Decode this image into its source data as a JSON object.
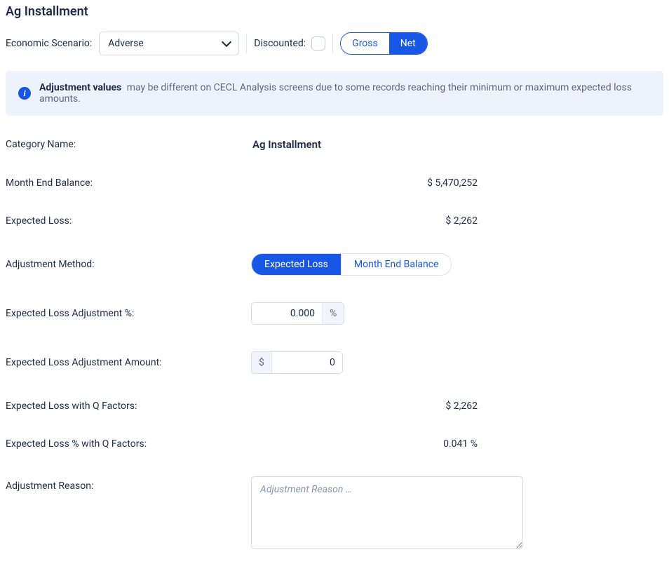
{
  "page_title": "Ag Installment",
  "controls": {
    "scenario_label": "Economic Scenario:",
    "scenario_value": "Adverse",
    "discounted_label": "Discounted:",
    "discounted_checked": false,
    "gross_label": "Gross",
    "net_label": "Net",
    "grossnet_active": "Net"
  },
  "banner": {
    "bold": "Adjustment values",
    "rest": "may be different on CECL Analysis screens due to some records reaching their minimum or maximum expected loss amounts."
  },
  "fields": {
    "category_name": {
      "label": "Category Name:",
      "value": "Ag Installment"
    },
    "month_end_balance": {
      "label": "Month End Balance:",
      "value": "$ 5,470,252"
    },
    "expected_loss": {
      "label": "Expected Loss:",
      "value": "$ 2,262"
    },
    "adjustment_method": {
      "label": "Adjustment Method:",
      "opt_expected_loss": "Expected Loss",
      "opt_month_end": "Month End Balance",
      "active": "Expected Loss"
    },
    "adj_pct": {
      "label": "Expected Loss Adjustment %:",
      "value": "0.000",
      "suffix": "%"
    },
    "adj_amt": {
      "label": "Expected Loss Adjustment Amount:",
      "value": "0",
      "prefix": "$"
    },
    "el_with_q": {
      "label": "Expected Loss with Q Factors:",
      "value": "$ 2,262"
    },
    "el_pct_with_q": {
      "label": "Expected Loss % with Q Factors:",
      "value": "0.041 %"
    },
    "reason": {
      "label": "Adjustment Reason:",
      "placeholder": "Adjustment Reason …",
      "value": ""
    }
  }
}
